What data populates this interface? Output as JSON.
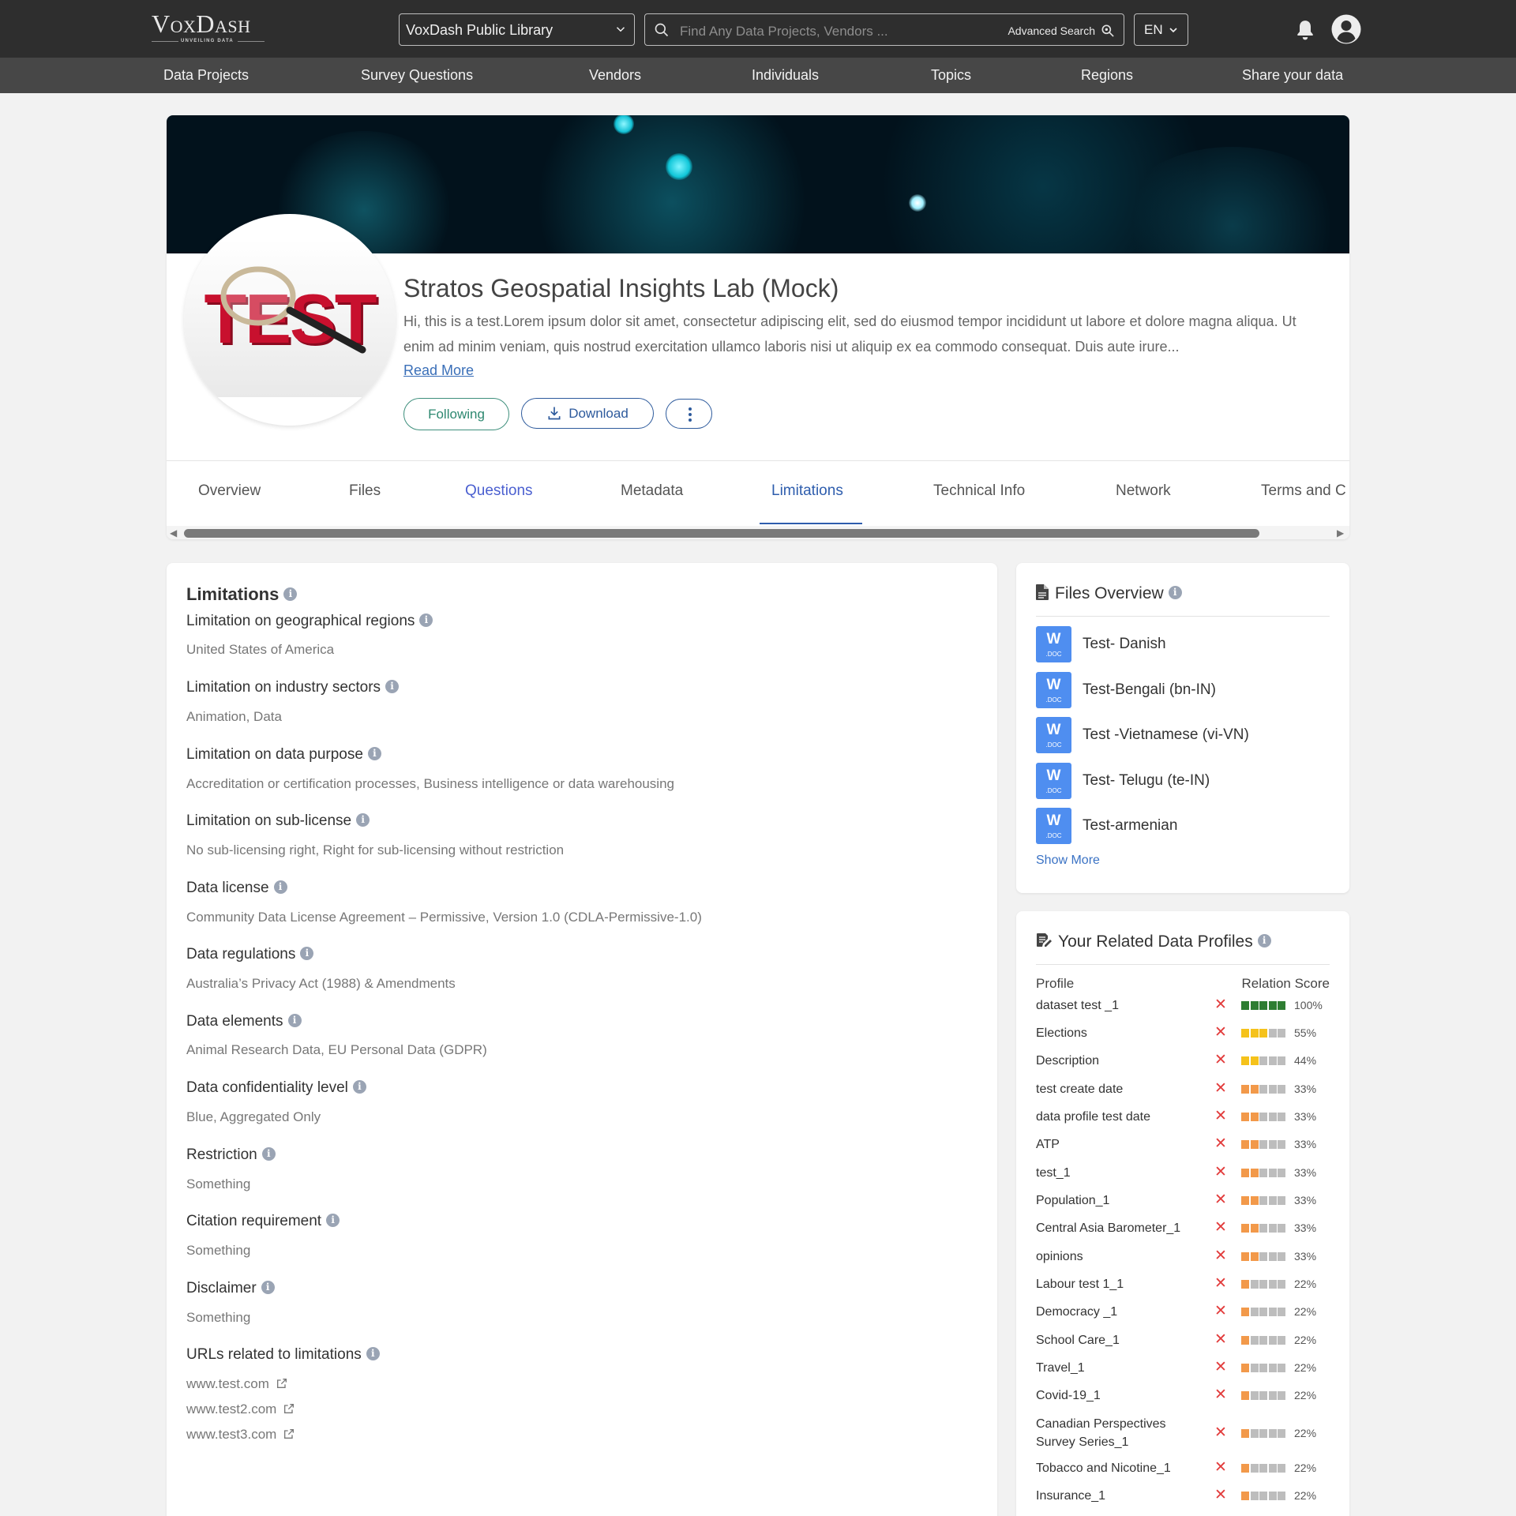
{
  "header": {
    "logo": "VoxDash",
    "logo_tagline": "UNVEILING DATA",
    "library_select": "VoxDash Public Library",
    "search_placeholder": "Find Any Data Projects, Vendors ...",
    "advanced_search": "Advanced Search",
    "language": "EN"
  },
  "nav": [
    "Data Projects",
    "Survey Questions",
    "Vendors",
    "Individuals",
    "Topics",
    "Regions",
    "Share your data"
  ],
  "profile": {
    "image_text": "TEST",
    "title": "Stratos Geospatial Insights Lab (Mock)",
    "description": "Hi, this is a test.Lorem ipsum dolor sit amet, consectetur adipiscing elit, sed do eiusmod tempor incididunt ut labore et dolore magna aliqua. Ut enim ad minim veniam, quis nostrud exercitation ullamco laboris nisi ut aliquip ex ea commodo consequat. Duis aute irure...",
    "read_more": "Read More",
    "following_label": "Following",
    "download_label": "Download"
  },
  "tabs": [
    "Overview",
    "Files",
    "Questions",
    "Metadata",
    "Limitations",
    "Technical Info",
    "Network",
    "Terms and C"
  ],
  "active_tab": "Limitations",
  "limitations": {
    "title": "Limitations",
    "items": [
      {
        "label": "Limitation on geographical regions",
        "value": "United States of America"
      },
      {
        "label": "Limitation on industry sectors",
        "value": "Animation, Data"
      },
      {
        "label": "Limitation on data purpose",
        "value": "Accreditation or certification processes, Business intelligence or data warehousing"
      },
      {
        "label": "Limitation on sub-license",
        "value": "No sub-licensing right, Right for sub-licensing without restriction"
      },
      {
        "label": "Data license",
        "value": "Community Data License Agreement – Permissive, Version 1.0 (CDLA-Permissive-1.0)"
      },
      {
        "label": "Data regulations",
        "value": "Australia’s Privacy Act (1988) & Amendments"
      },
      {
        "label": "Data elements",
        "value": "Animal Research Data, EU Personal Data (GDPR)"
      },
      {
        "label": "Data confidentiality level",
        "value": "Blue, Aggregated Only"
      },
      {
        "label": "Restriction",
        "value": "Something"
      },
      {
        "label": "Citation requirement",
        "value": "Something"
      },
      {
        "label": "Disclaimer",
        "value": "Something"
      }
    ],
    "urls_label": "URLs related to limitations",
    "urls": [
      "www.test.com",
      "www.test2.com",
      "www.test3.com"
    ]
  },
  "files_overview": {
    "title": "Files Overview",
    "doc_letter": "W",
    "doc_type": ".DOC",
    "files": [
      "Test- Danish",
      "Test-Bengali (bn-IN)",
      "Test -Vietnamese (vi-VN)",
      "Test- Telugu (te-IN)",
      "Test-armenian"
    ],
    "show_more": "Show More"
  },
  "related_profiles": {
    "title": "Your Related Data Profiles",
    "col_profile": "Profile",
    "col_score": "Relation Score",
    "remove_glyph": "✕",
    "colors": {
      "full": "#2e7d32",
      "mid": "#f5c21b",
      "low": "#f2994a",
      "empty": "#bdbdbd"
    },
    "rows": [
      {
        "name": "dataset test _1",
        "score": 100
      },
      {
        "name": "Elections",
        "score": 55
      },
      {
        "name": "Description",
        "score": 44
      },
      {
        "name": "test create date",
        "score": 33
      },
      {
        "name": "data profile test date",
        "score": 33
      },
      {
        "name": "ATP",
        "score": 33
      },
      {
        "name": "test_1",
        "score": 33
      },
      {
        "name": "Population_1",
        "score": 33
      },
      {
        "name": "Central Asia Barometer_1",
        "score": 33
      },
      {
        "name": "opinions",
        "score": 33
      },
      {
        "name": "Labour test 1_1",
        "score": 22
      },
      {
        "name": "Democracy _1",
        "score": 22
      },
      {
        "name": "School Care_1",
        "score": 22
      },
      {
        "name": "Travel_1",
        "score": 22
      },
      {
        "name": "Covid-19_1",
        "score": 22
      },
      {
        "name": "Canadian Perspectives Survey Series_1",
        "score": 22
      },
      {
        "name": "Tobacco and Nicotine_1",
        "score": 22
      },
      {
        "name": "Insurance_1",
        "score": 22
      }
    ]
  }
}
